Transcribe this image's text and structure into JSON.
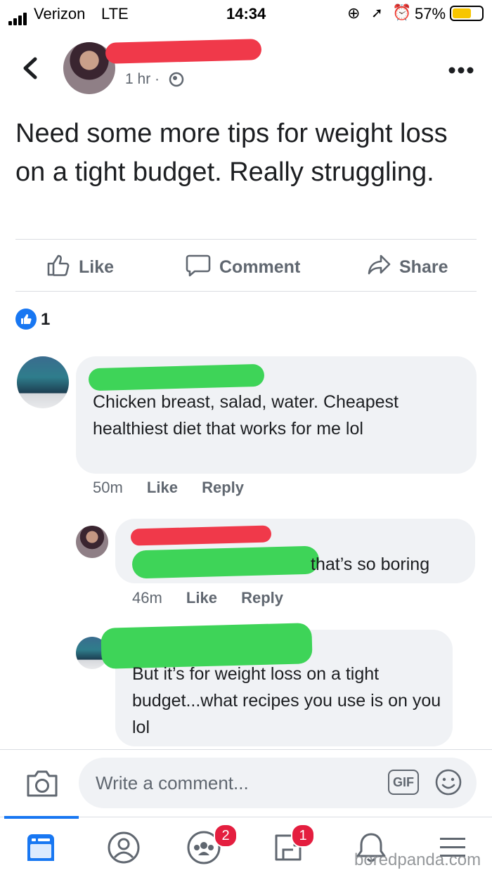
{
  "status_bar": {
    "carrier": "Verizon",
    "network": "LTE",
    "time": "14:34",
    "battery": "57%"
  },
  "post": {
    "timestamp": "1 hr ·",
    "text": "Need some more tips for weight loss on a tight budget. Really struggling.",
    "actions": {
      "like": "Like",
      "comment": "Comment",
      "share": "Share"
    },
    "reaction_count": "1"
  },
  "comments": [
    {
      "text": "Chicken breast, salad, water. Cheapest healthiest diet that works for me lol",
      "time": "50m",
      "like": "Like",
      "reply": "Reply"
    },
    {
      "text": "that’s so boring",
      "time": "46m",
      "like": "Like",
      "reply": "Reply"
    },
    {
      "text": "But it’s for weight loss on a tight budget...what recipes you use is on you lol"
    }
  ],
  "composer": {
    "placeholder": "Write a comment...",
    "gif": "GIF"
  },
  "tab_bar": {
    "groups_badge": "2",
    "marketplace_badge": "1"
  },
  "watermark": "boredpanda.com",
  "colors": {
    "accent": "#1877f2",
    "redaction_red": "#f0394a",
    "redaction_green": "#3ed458"
  }
}
